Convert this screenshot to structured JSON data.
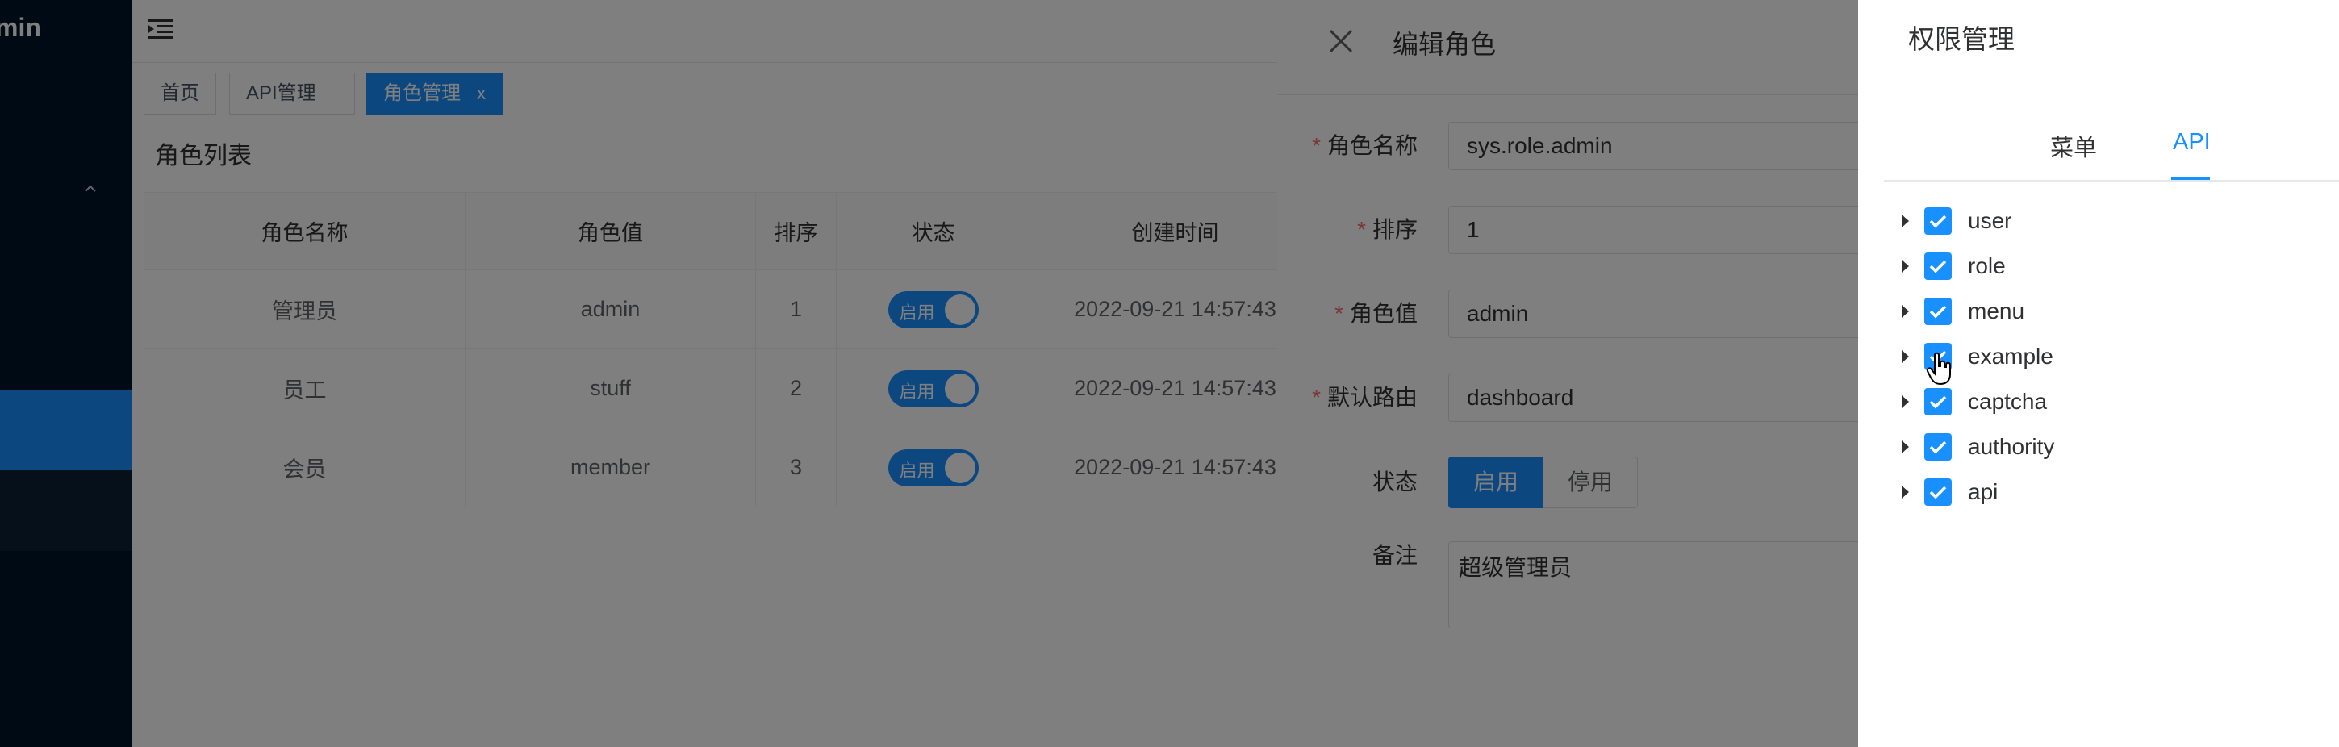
{
  "sidebar": {
    "logo_text": "min"
  },
  "tags": [
    {
      "label": "首页"
    },
    {
      "label": "API管理"
    },
    {
      "label": "角色管理",
      "close": "x"
    }
  ],
  "page": {
    "card_title": "角色列表"
  },
  "table": {
    "headers": [
      "角色名称",
      "角色值",
      "排序",
      "状态",
      "创建时间"
    ],
    "rows": [
      {
        "name": "管理员",
        "value": "admin",
        "order": "1",
        "status": "启用",
        "created": "2022-09-21 14:57:43"
      },
      {
        "name": "员工",
        "value": "stuff",
        "order": "2",
        "status": "启用",
        "created": "2022-09-21 14:57:43"
      },
      {
        "name": "会员",
        "value": "member",
        "order": "3",
        "status": "启用",
        "created": "2022-09-21 14:57:43"
      }
    ]
  },
  "edit_drawer": {
    "title": "编辑角色",
    "fields": {
      "role_name": {
        "label": "角色名称",
        "value": "sys.role.admin",
        "required": "*"
      },
      "order": {
        "label": "排序",
        "value": "1",
        "required": "*"
      },
      "role_value": {
        "label": "角色值",
        "value": "admin",
        "required": "*"
      },
      "default_route": {
        "label": "默认路由",
        "value": "dashboard",
        "required": "*"
      },
      "status": {
        "label": "状态",
        "options": [
          "启用",
          "停用"
        ],
        "selected": "启用"
      },
      "remark": {
        "label": "备注",
        "value": "超级管理员"
      }
    }
  },
  "perm_drawer": {
    "title": "权限管理",
    "tabs": [
      "菜单",
      "API"
    ],
    "active_tab": "API",
    "tree": [
      "user",
      "role",
      "menu",
      "example",
      "captcha",
      "authority",
      "api"
    ]
  },
  "colors": {
    "primary": "#1890ff",
    "sidebar": "#001529",
    "required": "#f56c6c"
  }
}
